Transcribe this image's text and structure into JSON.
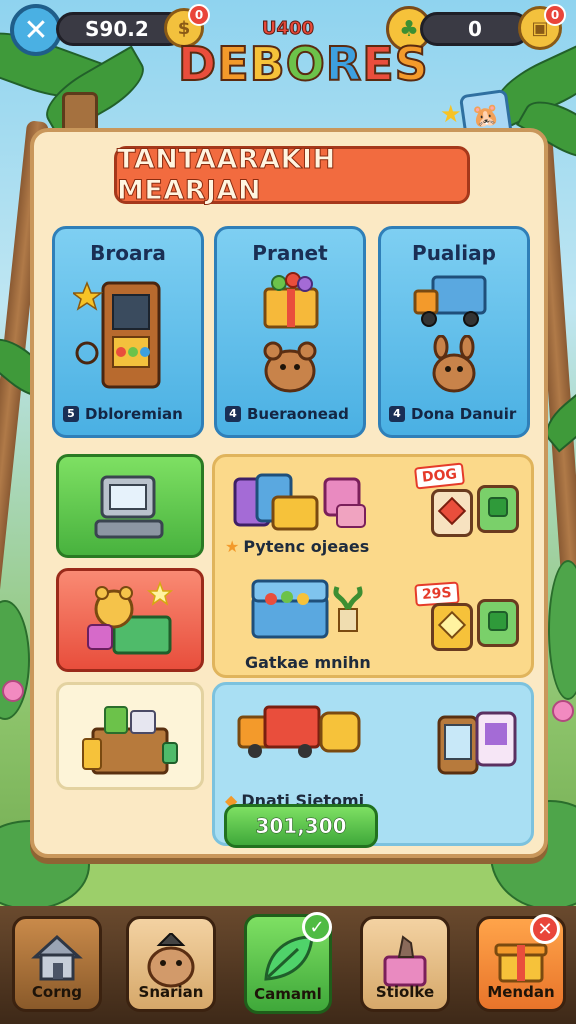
{
  "hud": {
    "coins": "S90.2",
    "coin_badge": "0",
    "gems": "0",
    "right_badge": "0"
  },
  "logo": {
    "small": "U400",
    "big": [
      "D",
      "E",
      "B",
      "O",
      "R",
      "E",
      "S"
    ]
  },
  "panel": {
    "title": "TANTAARAKIH MEARJAN",
    "cards": [
      {
        "title": "Broara",
        "num": "5",
        "label": "Dbloremian"
      },
      {
        "title": "Pranet",
        "num": "4",
        "label": "Bueraonead"
      },
      {
        "title": "Pualiap",
        "num": "4",
        "label": "Dona Danuir"
      }
    ],
    "items": [
      {
        "label": "Pytenc ojeaes",
        "tag": "DOG"
      },
      {
        "label": "Gatkae mnihn",
        "tag": "29S"
      },
      {
        "label": "Dnati Sietomi",
        "tag": ""
      }
    ],
    "price": "301,300"
  },
  "nav": [
    {
      "label": "Corng"
    },
    {
      "label": "Snarian"
    },
    {
      "label": "Camaml"
    },
    {
      "label": "Stiolke"
    },
    {
      "label": "Mendan"
    }
  ],
  "colors": {
    "accent": "#f26b3f",
    "green": "#4fbb43",
    "panel": "#fbe9c4",
    "blue": "#4ab0e3"
  }
}
